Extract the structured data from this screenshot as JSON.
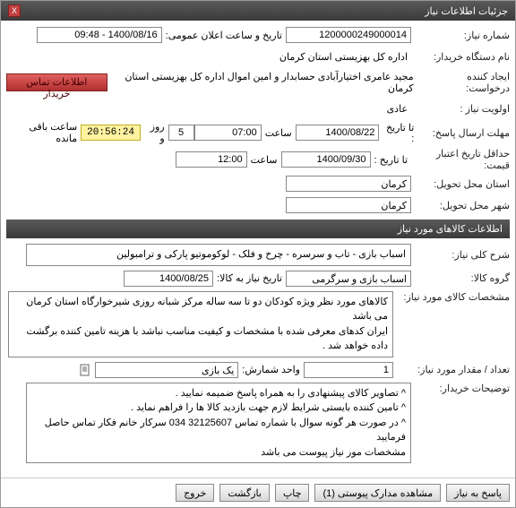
{
  "window": {
    "title": "جزئیات اطلاعات نیاز",
    "close": "X"
  },
  "labels": {
    "need_number": "شماره نیاز:",
    "public_announce_datetime": "تاریخ و ساعت اعلان عمومی:",
    "buyer_name": "نام دستگاه خریدار:",
    "creator": "ایجاد کننده درخواست:",
    "priority": "اولویت نیاز :",
    "deadline": "مهلت ارسال پاسخ:",
    "to_date": "تا تاریخ :",
    "time": "ساعت",
    "min_validity_date": "حداقل تاریخ اعتبار قیمت:",
    "state": "استان محل تحویل:",
    "city": "شهر محل تحویل:",
    "day_and": "روز و",
    "hours_remaining": "ساعت باقی مانده"
  },
  "values": {
    "need_number": "1200000249000014",
    "announce_datetime": "1400/08/16 - 09:48",
    "buyer_name": "اداره کل بهزیستی استان کرمان",
    "creator": "مجید عامری اختیارآبادی حسابدار و امین اموال اداره کل بهزیستی استان کرمان",
    "priority": "عادی",
    "deadline_date": "1400/08/22",
    "deadline_time": "07:00",
    "validity_date": "1400/09/30",
    "validity_time": "12:00",
    "state": "کرمان",
    "city": "کرمان",
    "days_left": "5",
    "countdown": "20:56:24"
  },
  "buttons": {
    "contact_buyer": "اطلاعات تماس خریدار"
  },
  "section2": {
    "title": "اطلاعات کالاهای مورد نیاز",
    "labels": {
      "general_desc": "شرح کلی نیاز:",
      "goods_group": "گروه کالا:",
      "date_need_goods": "تاریخ نیاز به کالا:",
      "goods_spec": "مشخصات کالای مورد نیاز:",
      "qty": "تعداد / مقدار مورد نیاز:",
      "unit": "واحد شمارش:",
      "buyer_notes": "توضیحات خریدار:"
    },
    "values": {
      "general_desc": "اسباب بازی - تاب و سرسره - چرخ و فلک - لوکوموتیو پارکی و ترامبولین",
      "goods_group": "اسباب بازی و سرگرمی",
      "date_need_goods": "1400/08/25",
      "goods_spec": "کالاهای مورد نظر ویژه کودکان دو تا سه ساله مرکز شبانه روزی شیرخوارگاه استان کرمان می باشد\nایران کدهای معرفی شده با مشخصات و کیفیت مناسب نباشد با هزینه تامین کننده برگشت داده خواهد شد .",
      "qty": "1",
      "unit": "یک بازی",
      "buyer_notes": "^ تصاویر کالای پیشنهادی را به همراه پاسخ ضمیمه نمایید .\n^ تامین کننده بایستی شرایط لازم جهت بازدید کالا ها را فراهم نماید .\n^ در صورت هر گونه سوال با شماره تماس 32125607 034 سرکار خانم فکار تماس حاصل فرمایید\nمشخصات مور نیاز پیوست می باشد"
    }
  },
  "footer": {
    "reply": "پاسخ به نیاز",
    "attachments": "مشاهده مدارک پیوستی (1)",
    "print": "چاپ",
    "back": "بازگشت",
    "exit": "خروج"
  }
}
